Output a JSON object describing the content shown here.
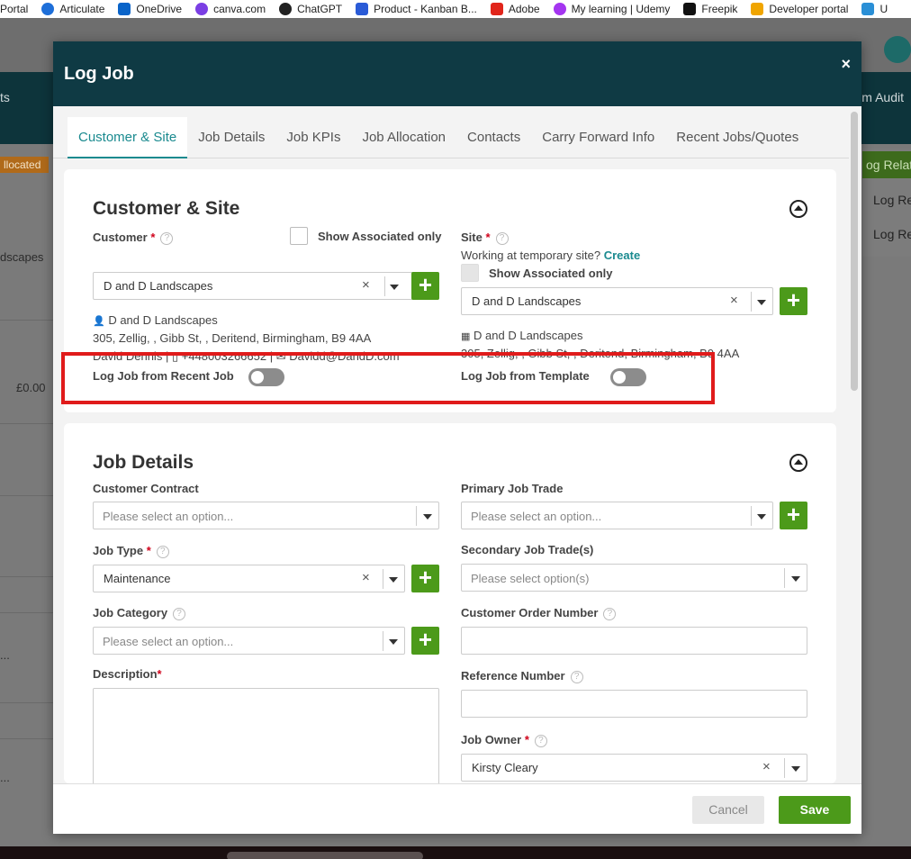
{
  "bookmarks": [
    {
      "label": "Portal",
      "color": "#7a7a7a"
    },
    {
      "label": "Articulate",
      "color": "#1e6fd9"
    },
    {
      "label": "OneDrive",
      "color": "#0a64c9"
    },
    {
      "label": "canva.com",
      "color": "#7b3fe4"
    },
    {
      "label": "ChatGPT",
      "color": "#222222"
    },
    {
      "label": "Product - Kanban B...",
      "color": "#2a5bd7"
    },
    {
      "label": "Adobe",
      "color": "#e1251b"
    },
    {
      "label": "My learning | Udemy",
      "color": "#a435f0"
    },
    {
      "label": "Freepik",
      "color": "#111111"
    },
    {
      "label": "Developer portal",
      "color": "#f0a500"
    },
    {
      "label": "U",
      "color": "#2a8fd6"
    }
  ],
  "background": {
    "nav_left": "ts",
    "nav_right": "m Audit",
    "allocated_badge": "llocated",
    "landscapes_text": "dscapes",
    "amount": "£0.00",
    "ellipsis": "...",
    "green_button": "og Relate",
    "log_re_1": "Log Re",
    "log_re_2": "Log Re"
  },
  "modal": {
    "title": "Log Job",
    "close": "×",
    "tabs": [
      {
        "label": "Customer & Site",
        "active": true
      },
      {
        "label": "Job Details",
        "active": false
      },
      {
        "label": "Job KPIs",
        "active": false
      },
      {
        "label": "Job Allocation",
        "active": false
      },
      {
        "label": "Contacts",
        "active": false
      },
      {
        "label": "Carry Forward Info",
        "active": false
      },
      {
        "label": "Recent Jobs/Quotes",
        "active": false
      }
    ],
    "customer_site": {
      "title": "Customer & Site",
      "customer_label": "Customer",
      "required_mark": "*",
      "help": "?",
      "show_associated": "Show Associated only",
      "customer_value": "D and D Landscapes",
      "clear": "×",
      "customer_info": {
        "name": "D and D Landscapes",
        "address": "305, Zellig, , Gibb St, , Deritend, Birmingham, B9 4AA",
        "contact_name": "David Dennis",
        "phone": "+448003266652",
        "email": "Davidd@DandD.com",
        "separator": "|"
      },
      "site_label": "Site",
      "temp_site_text": "Working at temporary site?",
      "create_link": "Create",
      "site_show_associated": "Show Associated only",
      "site_value": "D and D Landscapes",
      "site_info": {
        "name": "D and D Landscapes",
        "address": "305, Zellig, , Gibb St, , Deritend, Birmingham, B9 4AA"
      },
      "log_recent_label": "Log Job from Recent Job",
      "log_template_label": "Log Job from Template"
    },
    "job_details": {
      "title": "Job Details",
      "customer_contract_label": "Customer Contract",
      "customer_contract_placeholder": "Please select an option...",
      "primary_trade_label": "Primary Job Trade",
      "primary_trade_placeholder": "Please select an option...",
      "job_type_label": "Job Type",
      "job_type_value": "Maintenance",
      "secondary_trade_label": "Secondary Job Trade(s)",
      "secondary_trade_placeholder": "Please select option(s)",
      "job_category_label": "Job Category",
      "job_category_placeholder": "Please select an option...",
      "customer_order_label": "Customer Order Number",
      "description_label": "Description",
      "reference_label": "Reference Number",
      "job_owner_label": "Job Owner",
      "job_owner_value": "Kirsty Cleary"
    },
    "footer": {
      "cancel": "Cancel",
      "save": "Save"
    }
  }
}
